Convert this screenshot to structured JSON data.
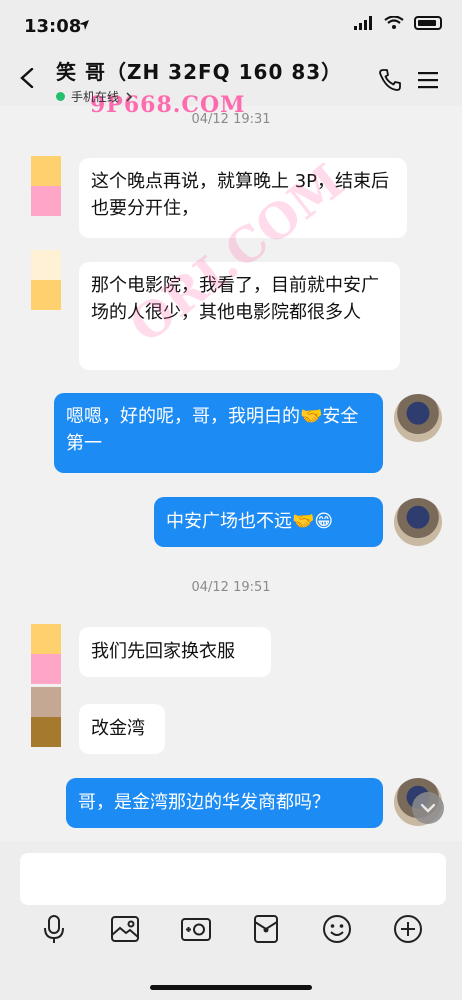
{
  "status_bar": {
    "time": "13:08"
  },
  "header": {
    "title": "笑 哥（ZH 32FQ 160 83）",
    "online_status": "手机在线",
    "watermark": "9P668.COM"
  },
  "watermarks": {
    "diagonal": "ORI.COM"
  },
  "messages": [
    {
      "type": "timestamp",
      "text": "04/12 19:31"
    },
    {
      "type": "incoming",
      "text": "这个晚点再说，就算晚上 3P，结束后也要分开住，",
      "avatar_colors": [
        "#ffd06e",
        "#ffa6c8"
      ]
    },
    {
      "type": "incoming",
      "text": "那个电影院，我看了，目前就中安广场的人很少，其他电影院都很多人",
      "avatar_colors": [
        "#fff1d6",
        "#ffd06e"
      ]
    },
    {
      "type": "outgoing",
      "text": "嗯嗯，好的呢，哥，我明白的🤝安全第一"
    },
    {
      "type": "outgoing",
      "text": "中安广场也不远🤝😁"
    },
    {
      "type": "timestamp",
      "text": "04/12 19:51"
    },
    {
      "type": "incoming",
      "text": "我们先回家换衣服",
      "avatar_colors": [
        "#ffd06e",
        "#ffa6c8"
      ]
    },
    {
      "type": "incoming",
      "text": "改金湾",
      "avatar_colors": [
        "#c4a894",
        "#a5792e"
      ]
    },
    {
      "type": "outgoing",
      "text": "哥，是金湾那边的华发商都吗？"
    }
  ],
  "input": {
    "placeholder": ""
  },
  "toolbar": [
    "microphone-icon",
    "image-icon",
    "camera-icon",
    "red-packet-icon",
    "emoji-icon",
    "plus-icon"
  ],
  "colors": {
    "outgoing_bubble": "#1d8bf4",
    "incoming_bubble": "#ffffff",
    "background": "#f1f1f1",
    "online_dot": "#25c06d"
  }
}
